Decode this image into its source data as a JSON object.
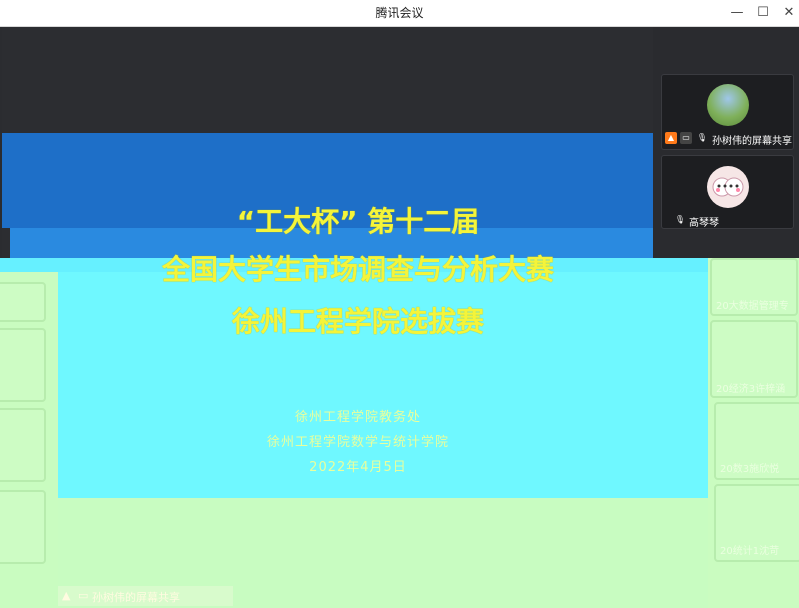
{
  "window": {
    "title": "腾讯会议",
    "controls": [
      "—",
      "☐",
      "✕"
    ]
  },
  "slide": {
    "line1": "“工大杯”  第十二届",
    "line2": "全国大学生市场调查与分析大赛",
    "line3": "徐州工程学院选拔赛",
    "org1": "徐州工程学院教务处",
    "org2": "徐州工程学院数学与统计学院",
    "date": "2022年4月5日"
  },
  "participants": [
    {
      "name": "孙树伟的屏幕共享"
    },
    {
      "name": "高琴琴"
    }
  ],
  "ghost_participants": [
    {
      "name": "20大数据管理专"
    },
    {
      "name": "20经济3许梓涵"
    },
    {
      "name": "20数3施欣悦"
    },
    {
      "name": "20统计1沈苛"
    }
  ],
  "bottom_share_label": "孙树伟的屏幕共享",
  "colors": {
    "accent": "#f4f43a",
    "share_badge": "#ff7a1a",
    "slide_blue": "#1e6fc8"
  }
}
